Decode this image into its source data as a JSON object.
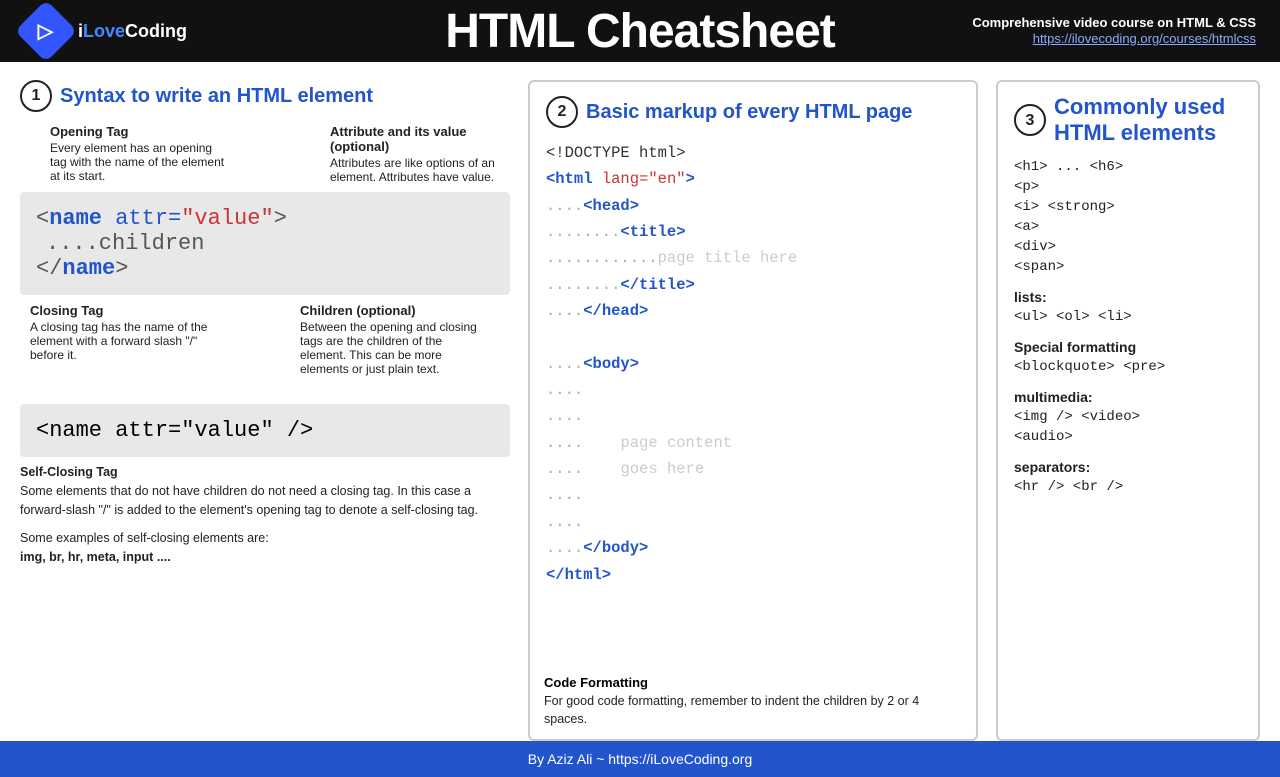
{
  "header": {
    "logo_text": "iLoveCoding",
    "title": "HTML Cheatsheet",
    "course_label": "Comprehensive video course on HTML & CSS",
    "course_url": "https://ilovecoding.org/courses/htmlcss"
  },
  "section1": {
    "number": "1",
    "title": "Syntax to write an HTML element",
    "annotation_opening_tag_title": "Opening Tag",
    "annotation_opening_tag_desc": "Every element has an opening tag with the name of the element at its start.",
    "annotation_attribute_title": "Attribute and its value (optional)",
    "annotation_attribute_desc": "Attributes are like options of an element. Attributes have value.",
    "code_line1": "< name  attr=\"value\" >",
    "code_line2": "....children",
    "code_line3": "</ name >",
    "annotation_closing_tag_title": "Closing Tag",
    "annotation_closing_tag_desc": "A closing tag has the name of the element with a forward slash \"/\" before it.",
    "annotation_children_title": "Children (optional)",
    "annotation_children_desc": "Between the opening and closing tags are the children of the element. This can be more elements or just plain text.",
    "self_close_line": "< name  attr=\"value\" />",
    "self_close_title": "Self-Closing Tag",
    "self_close_desc": "Some elements that do not have children do not need a closing tag. In this case a forward-slash \"/\" is added to the element's opening tag to denote a self-closing tag.",
    "examples_label": "Some examples of self-closing elements are:",
    "examples_list": "img, br, hr, meta, input ...."
  },
  "section2": {
    "number": "2",
    "title": "Basic markup of every HTML page",
    "code_lines": [
      "<!DOCTYPE html>",
      "<html lang=\"en\">",
      "    <head>",
      "        <title>",
      "            page title here",
      "        </title>",
      "    </head>",
      "",
      "    <body>",
      "    ....",
      "    ....",
      "    ....    page content",
      "    ....    goes here",
      "    ....",
      "    ....",
      "    </body>",
      "</html>"
    ],
    "footer_title": "Code Formatting",
    "footer_desc": "For good code formatting, remember to indent the children by 2 or 4 spaces."
  },
  "section3": {
    "number": "3",
    "title": "Commonly used HTML elements",
    "items": [
      {
        "text": "<h1> ... <h6>"
      },
      {
        "text": "<p>"
      },
      {
        "text": "<i>  <strong>"
      },
      {
        "text": "<a>"
      },
      {
        "text": "<div>"
      },
      {
        "text": "<span>"
      }
    ],
    "groups": [
      {
        "label": "lists:",
        "items": [
          "<ul>  <ol>  <li>"
        ]
      },
      {
        "label": "Special formatting",
        "items": [
          "<blockquote>  <pre>"
        ]
      },
      {
        "label": "multimedia:",
        "items": [
          "<img />  <video>",
          "<audio>"
        ]
      },
      {
        "label": "separators:",
        "items": [
          "<hr />  <br />"
        ]
      }
    ]
  },
  "footer": {
    "text": "By Aziz Ali ~ https://iLoveCoding.org"
  }
}
